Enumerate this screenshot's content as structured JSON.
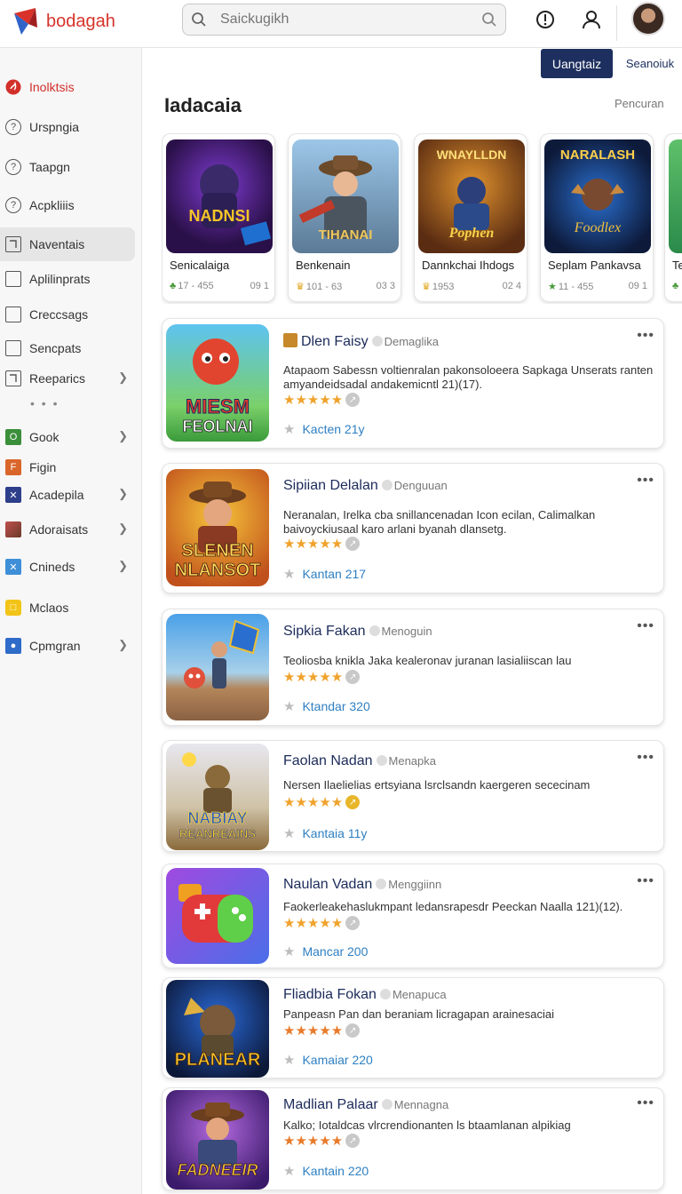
{
  "header": {
    "logo_text": "bodagah",
    "search_placeholder": "Saickugikh"
  },
  "sidebar": {
    "items": [
      {
        "label": "Inolktsis",
        "icon": "flame-icon"
      },
      {
        "label": "Urspngia",
        "icon": "question-icon"
      },
      {
        "label": "Taapgn",
        "icon": "question-icon"
      },
      {
        "label": "Acpkliiis",
        "icon": "question-icon"
      },
      {
        "label": "Naventais",
        "icon": "document-icon"
      },
      {
        "label": "Aplilinprats",
        "icon": "square-icon"
      },
      {
        "label": "Creccsags",
        "icon": "square-icon"
      },
      {
        "label": "Sencpats",
        "icon": "square-icon"
      },
      {
        "label": "Reeparics",
        "icon": "document-icon"
      },
      {
        "label": "Gook",
        "icon": "green-o-icon"
      },
      {
        "label": "Figin",
        "icon": "orange-f-icon"
      },
      {
        "label": "Acadepila",
        "icon": "navy-x-icon"
      },
      {
        "label": "Adoraisats",
        "icon": "photo-icon"
      },
      {
        "label": "Cnineds",
        "icon": "blue-cross-icon"
      },
      {
        "label": "Mclaos",
        "icon": "yellow-chat-icon"
      },
      {
        "label": "Cpmgran",
        "icon": "blue-user-icon"
      }
    ],
    "more": "• • •"
  },
  "toolbar": {
    "primary_label": "Uangtaiz",
    "secondary_label": "Seanoiuk"
  },
  "section": {
    "title": "Iadacaia",
    "more": "Pencuran"
  },
  "featured": [
    {
      "name": "Senicalaiga",
      "rating": "17 - 455",
      "count": "09 1",
      "art_text": "NADNSI",
      "icon": "trophy-icon"
    },
    {
      "name": "Benkenain",
      "rating": "101 - 63",
      "count": "03 3",
      "art_text": "TIHANAI",
      "icon": "crown-icon"
    },
    {
      "name": "Dannkchai Ihdogs",
      "rating": "1953",
      "count": "02 4",
      "art_text": "Pophen",
      "icon": "crown-icon"
    },
    {
      "name": "Seplam Pankavsa",
      "rating": "11 - 455",
      "count": "09 1",
      "art_text": "NARALASH",
      "icon": "star-icon"
    },
    {
      "name": "Te",
      "rating": "",
      "count": "",
      "art_text": "",
      "icon": "trophy-icon"
    }
  ],
  "list": [
    {
      "title": "Dlen Faisy",
      "tag": "Demaglika",
      "desc": "Atapaom Sabessn voltienralan pakonsoloeera Sapkaga Unserats ranten amyandeidsadal andakemicntl 21)(17).",
      "stars": "★★★★★",
      "count": "Kacten 21y",
      "art_text": "MIESM FEOLNAI"
    },
    {
      "title": "Sipiian Delalan",
      "tag": "Denguuan",
      "desc": "Neranalan, Irelka cba snillancenadan Icon ecilan, Calimalkan baivoyckiusaal karo arlani byanah dlansetg.",
      "stars": "★★★★★",
      "count": "Kantan 217",
      "art_text": "SLENEN NLANSOT"
    },
    {
      "title": "Sipkia Fakan",
      "tag": "Menoguin",
      "desc": "Teoliosba knikla Jaka kealeronav juranan lasialiiscan lau",
      "stars": "★★★★★",
      "count": "Ktandar 320",
      "art_text": ""
    },
    {
      "title": "Faolan Nadan",
      "tag": "Menapka",
      "desc": "Nersen Ilaelielias ertsyiana lsrclsandn kaergeren sececinam",
      "stars": "★★★★★",
      "count": "Kantaia 11y",
      "art_text": "NABIAY REANREAINS"
    },
    {
      "title": "Naulan Vadan",
      "tag": "Menggiinn",
      "desc": "Faokerleakehaslukmpant ledansrapesdr Peeckan Naalla 121)(12).",
      "stars": "★★★★★",
      "count": "Mancar 200",
      "art_text": ""
    },
    {
      "title": "Fliadbia Fokan",
      "tag": "Menapuca",
      "desc": "Panpeasn Pan dan beraniam licragapan arainesaciai",
      "stars": "★★★★★",
      "count": "Kamaiar 220",
      "art_text": "PLANEAR"
    },
    {
      "title": "Madlian Palaar",
      "tag": "Mennagna",
      "desc": "Kalko; Iotaldcas vlrcrendionanten ls btaamlanan alpikiag",
      "stars": "★★★★★",
      "count": "Kantain 220",
      "art_text": "FADNEEIR"
    }
  ]
}
